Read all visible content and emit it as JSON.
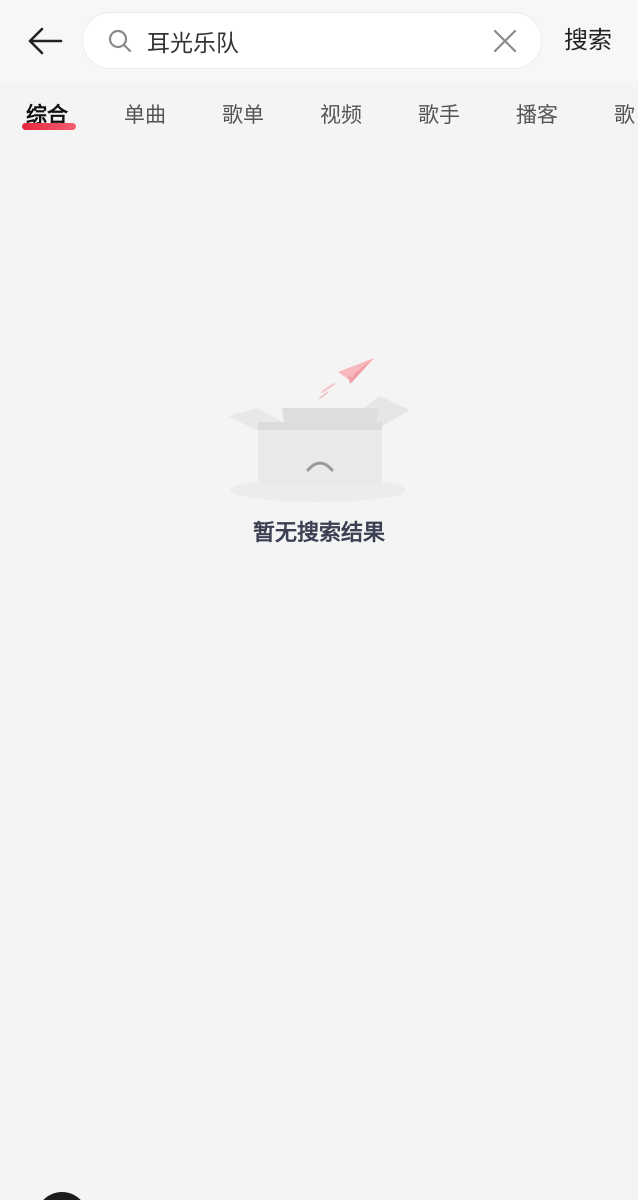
{
  "header": {
    "back_icon": "arrow-left-icon",
    "search": {
      "value": "耳光乐队",
      "placeholder": "",
      "search_icon": "search-icon",
      "clear_icon": "close-icon"
    },
    "search_button_label": "搜索"
  },
  "tabs": [
    {
      "label": "综合",
      "active": true
    },
    {
      "label": "单曲",
      "active": false
    },
    {
      "label": "歌单",
      "active": false
    },
    {
      "label": "视频",
      "active": false
    },
    {
      "label": "歌手",
      "active": false
    },
    {
      "label": "播客",
      "active": false
    },
    {
      "label": "歌",
      "active": false
    }
  ],
  "empty_state": {
    "message": "暂无搜索结果",
    "illustration": "empty-box-paper-plane"
  },
  "colors": {
    "accent": "#e8243c",
    "background": "#f4f4f4",
    "empty_text": "#3b4153"
  }
}
